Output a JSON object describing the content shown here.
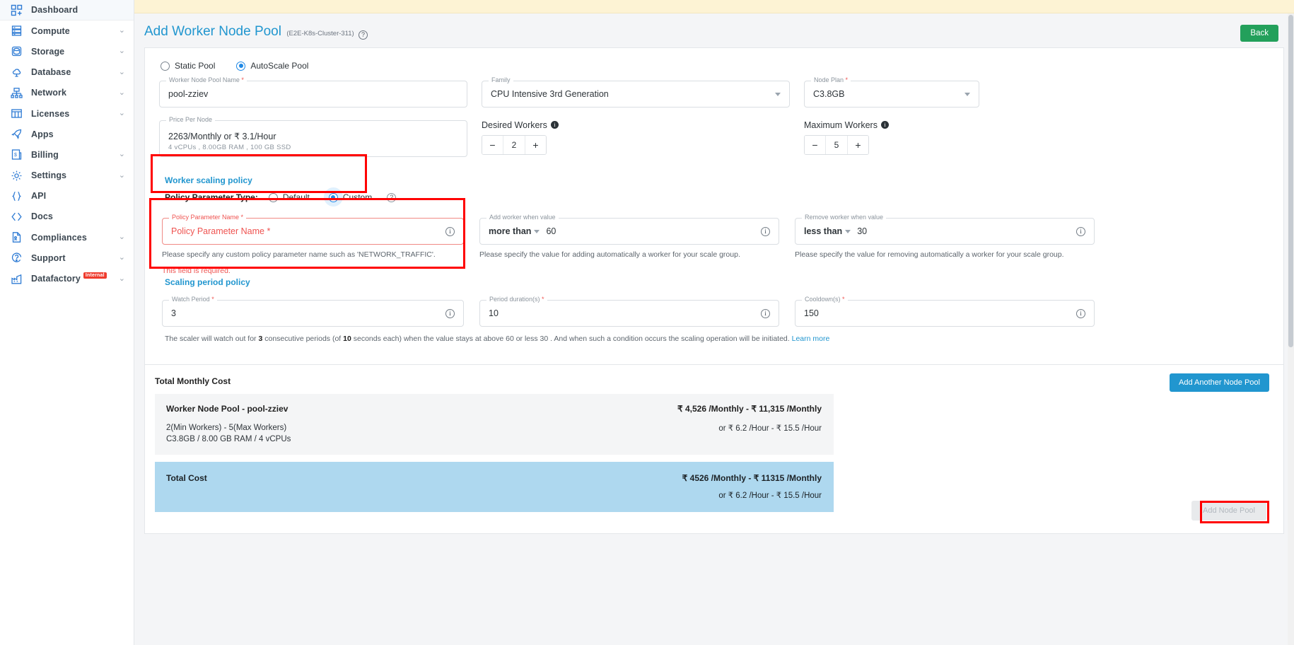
{
  "sidebar": {
    "items": [
      {
        "label": "Dashboard",
        "icon": "dashboard-icon",
        "caret": false,
        "badge": null
      },
      {
        "label": "Compute",
        "icon": "server-icon",
        "caret": true,
        "badge": null
      },
      {
        "label": "Storage",
        "icon": "database-icon",
        "caret": true,
        "badge": null
      },
      {
        "label": "Database",
        "icon": "db-cloud-icon",
        "caret": true,
        "badge": null
      },
      {
        "label": "Network",
        "icon": "network-icon",
        "caret": true,
        "badge": null
      },
      {
        "label": "Licenses",
        "icon": "licenses-icon",
        "caret": true,
        "badge": null
      },
      {
        "label": "Apps",
        "icon": "rocket-icon",
        "caret": false,
        "badge": null
      },
      {
        "label": "Billing",
        "icon": "billing-icon",
        "caret": true,
        "badge": null
      },
      {
        "label": "Settings",
        "icon": "gear-icon",
        "caret": true,
        "badge": null
      },
      {
        "label": "API",
        "icon": "braces-icon",
        "caret": false,
        "badge": null
      },
      {
        "label": "Docs",
        "icon": "code-icon",
        "caret": false,
        "badge": null
      },
      {
        "label": "Compliances",
        "icon": "document-icon",
        "caret": true,
        "badge": null
      },
      {
        "label": "Support",
        "icon": "support-icon",
        "caret": true,
        "badge": null
      },
      {
        "label": "Datafactory",
        "icon": "datafactory-icon",
        "caret": true,
        "badge": "Internal"
      }
    ],
    "caret_glyph": "⌄"
  },
  "header": {
    "title": "Add Worker Node Pool",
    "cluster": "(E2E-K8s-Cluster-311)",
    "help_glyph": "?",
    "back_label": "Back"
  },
  "pool_type": {
    "options": [
      {
        "label": "Static Pool",
        "selected": false
      },
      {
        "label": "AutoScale Pool",
        "selected": true
      }
    ]
  },
  "fields": {
    "pool_name": {
      "label": "Worker Node Pool Name",
      "required": true,
      "value": "pool-zziev"
    },
    "family": {
      "label": "Family",
      "required": false,
      "value": "CPU Intensive 3rd Generation"
    },
    "node_plan": {
      "label": "Node Plan",
      "required": true,
      "value": "C3.8GB"
    },
    "price_per_node": {
      "label": "Price Per Node",
      "value": "2263/Monthly or ₹ 3.1/Hour",
      "spec": "4  vCPUs ,   8.00GB RAM ,   100 GB SSD"
    },
    "desired_workers": {
      "label": "Desired Workers",
      "value": "2",
      "minus": "−",
      "plus": "+"
    },
    "maximum_workers": {
      "label": "Maximum Workers",
      "value": "5",
      "minus": "−",
      "plus": "+"
    }
  },
  "worker_scaling_policy": {
    "section_title": "Worker scaling policy",
    "param_type_label": "Policy Parameter Type:",
    "options": [
      {
        "label": "Default",
        "selected": false
      },
      {
        "label": "Custom",
        "selected": true
      }
    ],
    "help_glyph": "?"
  },
  "policy_params": {
    "name": {
      "label": "Policy Parameter Name",
      "required": true,
      "value": "",
      "hint": "Please specify any custom policy parameter name such as 'NETWORK_TRAFFIC'.",
      "error": "This field is required."
    },
    "add_when": {
      "label": "Add worker when value",
      "operator": "more than",
      "value": "60",
      "hint": "Please specify the value for adding automatically a worker for your scale group."
    },
    "remove_when": {
      "label": "Remove worker when value",
      "operator": "less than",
      "value": "30",
      "hint": "Please specify the value for removing automatically a worker for your scale group."
    }
  },
  "scaling_period_policy": {
    "section_title": "Scaling period policy",
    "watch_period": {
      "label": "Watch Period",
      "required": true,
      "value": "3"
    },
    "period_duration": {
      "label": "Period duration(s)",
      "required": true,
      "value": "10"
    },
    "cooldown": {
      "label": "Cooldown(s)",
      "required": true,
      "value": "150"
    },
    "summary_prefix": "The scaler will watch out for ",
    "summary_watch": "3",
    "summary_mid1": " consecutive periods (of ",
    "summary_duration": "10",
    "summary_mid2": " seconds each) when the value stays at above 60 or less 30 . And when such a condition occurs the scaling operation will be initiated. ",
    "learn_more": "Learn more"
  },
  "cost": {
    "heading": "Total Monthly Cost",
    "add_another_label": "Add Another Node Pool",
    "pool": {
      "title": "Worker Node Pool - pool-zziev",
      "workers": "2(Min Workers) - 5(Max Workers)",
      "spec": "C3.8GB / 8.00 GB RAM / 4 vCPUs",
      "monthly": "₹ 4,526 /Monthly - ₹ 11,315 /Monthly",
      "hourly": "or ₹ 6.2 /Hour - ₹ 15.5 /Hour"
    },
    "total": {
      "label": "Total Cost",
      "monthly": "₹ 4526 /Monthly - ₹ 11315 /Monthly",
      "hourly": "or ₹ 6.2 /Hour - ₹ 15.5 /Hour"
    },
    "submit_label": "Add Node Pool"
  },
  "colors": {
    "brand_blue": "#2196cf",
    "accent_green": "#23a05b",
    "error_red": "#ef5350",
    "annotation_red": "#ff0000",
    "total_band": "#aed8ef",
    "warning_band": "#fdf3d4"
  }
}
